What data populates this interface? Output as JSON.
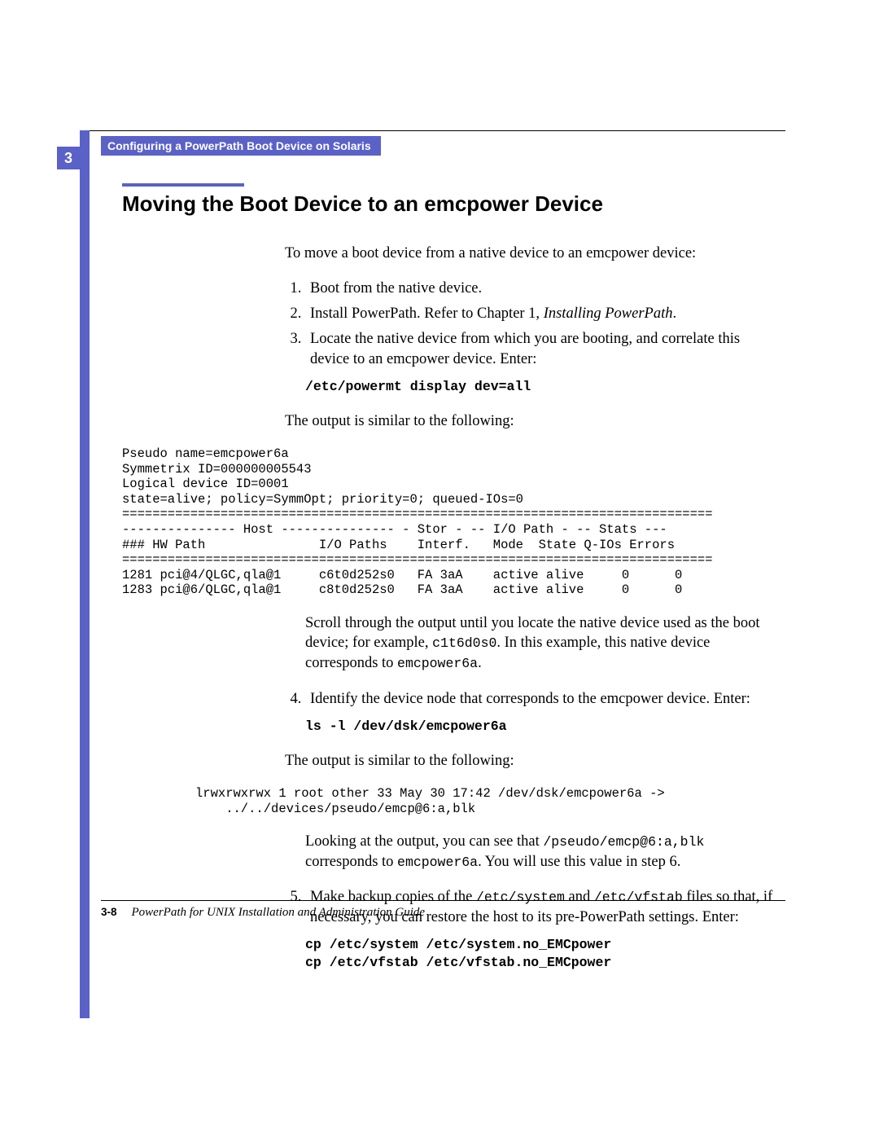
{
  "chapter_number": "3",
  "header_title": "Configuring a PowerPath Boot Device on Solaris",
  "section_heading": "Moving the Boot Device to an emcpower Device",
  "intro": "To move a boot device from a native device to an emcpower device:",
  "step1": "Boot from the native device.",
  "step2_a": "Install PowerPath. Refer to Chapter 1, ",
  "step2_b": "Installing PowerPath",
  "step2_c": ".",
  "step3": "Locate the native device from which you are booting, and correlate this device to an emcpower device. Enter:",
  "cmd1": "/etc/powermt display dev=all",
  "output_label": "The output is similar to the following:",
  "output1": "Pseudo name=emcpower6a\nSymmetrix ID=000000005543\nLogical device ID=0001\nstate=alive; policy=SymmOpt; priority=0; queued-IOs=0\n==============================================================================\n--------------- Host --------------- - Stor - -- I/O Path - -- Stats ---\n### HW Path               I/O Paths    Interf.   Mode  State Q-IOs Errors\n==============================================================================\n1281 pci@4/QLGC,qla@1     c6t0d252s0   FA 3aA    active alive     0      0\n1283 pci@6/QLGC,qla@1     c8t0d252s0   FA 3aA    active alive     0      0",
  "step3_follow_a": "Scroll through the output until you locate the native device used as the boot device; for example, ",
  "step3_follow_b": "c1t6d0s0",
  "step3_follow_c": ". In this example, this native device corresponds to ",
  "step3_follow_d": "emcpower6a",
  "step3_follow_e": ".",
  "step4": "Identify the device node that corresponds to the emcpower device. Enter:",
  "cmd2": "ls -l /dev/dsk/emcpower6a",
  "output2": "lrwxrwxrwx 1 root other 33 May 30 17:42 /dev/dsk/emcpower6a ->\n    ../../devices/pseudo/emcp@6:a,blk",
  "step4_follow_a": "Looking at the output, you can see that ",
  "step4_follow_b": "/pseudo/emcp@6:a,blk",
  "step4_follow_c": " corresponds to ",
  "step4_follow_d": "emcpower6a",
  "step4_follow_e": ". You will use this value in step 6.",
  "step5_a": "Make backup copies of the ",
  "step5_b": "/etc/system",
  "step5_c": " and ",
  "step5_d": "/etc/vfstab",
  "step5_e": " files so that, if necessary, you can restore the host to its pre-PowerPath settings. Enter:",
  "cmd3a": "cp /etc/system /etc/system.no_EMCpower",
  "cmd3b": "cp /etc/vfstab /etc/vfstab.no_EMCpower",
  "footer_page": "3-8",
  "footer_doc": "PowerPath for UNIX Installation and Administration Guide"
}
